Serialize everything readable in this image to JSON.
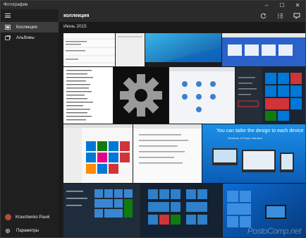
{
  "window": {
    "title": "Фотографии",
    "controls": [
      "–",
      "☐",
      "✕"
    ]
  },
  "sidebar": {
    "items": [
      {
        "label": "Коллекция",
        "icon": "collection-icon",
        "active": true
      },
      {
        "label": "Альбомы",
        "icon": "albums-icon",
        "active": false
      }
    ],
    "user": "Kravchenko Pavel",
    "settings": "Параметры"
  },
  "header": {
    "title": "коллекция",
    "icons": [
      "refresh-icon",
      "select-icon",
      "slideshow-icon"
    ]
  },
  "content": {
    "month": "Июнь 2015",
    "tile_caption": "You can tailor the design to each device",
    "tile_subcaption": "Windows 10 Store Interface"
  },
  "watermark": "PostoComp.net",
  "colors": {
    "accent": "#0078d7",
    "sidebar": "#1f1f1f",
    "header": "#2b2b2b"
  }
}
